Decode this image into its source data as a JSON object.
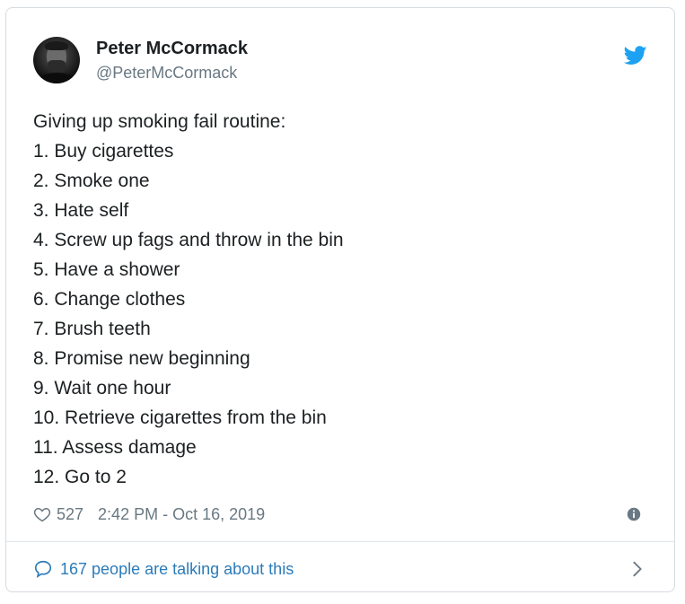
{
  "author": {
    "name": "Peter McCormack",
    "handle": "@PeterMcCormack"
  },
  "tweet": {
    "lines": [
      "Giving up smoking fail routine:",
      "1. Buy cigarettes",
      "2. Smoke one",
      "3. Hate self",
      "4. Screw up fags and throw in the bin",
      "5. Have a shower",
      "6. Change clothes",
      "7. Brush teeth",
      "8. Promise new beginning",
      "9. Wait one hour",
      "10. Retrieve cigarettes from the bin",
      "11. Assess damage",
      "12. Go to 2"
    ]
  },
  "meta": {
    "likes": "527",
    "timestamp": "2:42 PM - Oct 16, 2019"
  },
  "footer": {
    "talking": "167 people are talking about this"
  },
  "icons": {
    "bird": "twitter-bird-icon",
    "heart": "heart-icon",
    "info": "info-icon",
    "bubble": "speech-bubble-icon",
    "chevron": "chevron-right-icon"
  },
  "colors": {
    "brand": "#1da1f2",
    "link": "#2b7bb9",
    "muted": "#697882",
    "text": "#1c2022"
  }
}
